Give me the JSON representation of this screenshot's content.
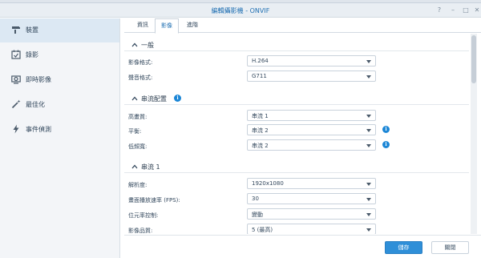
{
  "window": {
    "title": "編輯攝影機 - ONVIF",
    "help_glyph": "?",
    "minimize_glyph": "–",
    "maximize_glyph": "□",
    "close_glyph": "✕"
  },
  "sidebar": {
    "items": [
      {
        "label": "裝置",
        "icon": "device-icon",
        "active": true
      },
      {
        "label": "錄影",
        "icon": "calendar-icon",
        "active": false
      },
      {
        "label": "即時影像",
        "icon": "camera-icon",
        "active": false
      },
      {
        "label": "最佳化",
        "icon": "magic-wand-icon",
        "active": false
      },
      {
        "label": "事件偵測",
        "icon": "lightning-icon",
        "active": false
      }
    ]
  },
  "tabs": [
    {
      "label": "資訊",
      "active": false
    },
    {
      "label": "影像",
      "active": true
    },
    {
      "label": "進階",
      "active": false
    }
  ],
  "sections": {
    "general": {
      "title": "一般",
      "rows": [
        {
          "label": "影像格式:",
          "value": "H.264"
        },
        {
          "label": "聲音格式:",
          "value": "G711"
        }
      ]
    },
    "stream_config": {
      "title": "串流配置",
      "rows": [
        {
          "label": "高畫質:",
          "value": "串流 1"
        },
        {
          "label": "平衡:",
          "value": "串流 2"
        },
        {
          "label": "低頻寬:",
          "value": "串流 2"
        }
      ]
    },
    "stream1": {
      "title": "串流 1",
      "rows": [
        {
          "label": "解析度:",
          "value": "1920x1080"
        },
        {
          "label": "畫面播放速率 (FPS):",
          "value": "30"
        },
        {
          "label": "位元率控制:",
          "value": "變動"
        },
        {
          "label": "影像品質:",
          "value": "5 (最高)"
        }
      ]
    }
  },
  "info_glyph": "i",
  "footer": {
    "save_label": "儲存",
    "close_label": "關閉"
  },
  "colors": {
    "accent": "#2f8fd8",
    "info": "#1b86d6",
    "sidebar_active": "#dce8f3"
  }
}
